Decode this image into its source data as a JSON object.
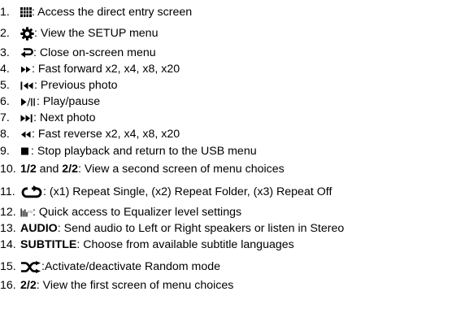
{
  "items": [
    {
      "num": "1.",
      "icon": "direct-entry-grid-icon",
      "text": ": Access the direct entry screen"
    },
    {
      "num": "2.",
      "icon": "setup-gear-icon",
      "text": ": View the SETUP menu"
    },
    {
      "num": "3.",
      "icon": "return-arrow-icon",
      "text": ": Close on-screen menu"
    },
    {
      "num": "4.",
      "icon": "fast-forward-icon",
      "text": ": Fast forward x2, x4, x8, x20"
    },
    {
      "num": "5.",
      "icon": "previous-track-icon",
      "text": ": Previous photo"
    },
    {
      "num": "6.",
      "icon": "play-pause-icon",
      "text": ": Play/pause"
    },
    {
      "num": "7.",
      "icon": "next-track-icon",
      "text": ": Next photo"
    },
    {
      "num": "8.",
      "icon": "fast-reverse-icon",
      "text": ": Fast reverse x2, x4, x8, x20"
    },
    {
      "num": "9.",
      "icon": "stop-icon",
      "text": ": Stop playback and return to the USB menu"
    },
    {
      "num": "10.",
      "bold1": "1/2",
      "mid": " and ",
      "bold2": "2/2",
      "text": ": View a second screen of menu choices"
    },
    {
      "num": "11.",
      "icon": "repeat-icon",
      "text": ": (x1) Repeat Single, (x2) Repeat Folder, (x3) Repeat Off"
    },
    {
      "num": "12.",
      "icon": "equalizer-icon",
      "text": ": Quick access to Equalizer level settings"
    },
    {
      "num": "13.",
      "bold1": "AUDIO",
      "text": ": Send audio to Left or Right speakers or listen in Stereo"
    },
    {
      "num": "14.",
      "bold1": "SUBTITLE",
      "text": ": Choose from available subtitle languages"
    },
    {
      "num": "15.",
      "icon": "shuffle-icon",
      "text": ":Activate/deactivate Random mode"
    },
    {
      "num": "16.",
      "bold1": "2/2",
      "text": ": View the first screen of menu choices"
    }
  ]
}
